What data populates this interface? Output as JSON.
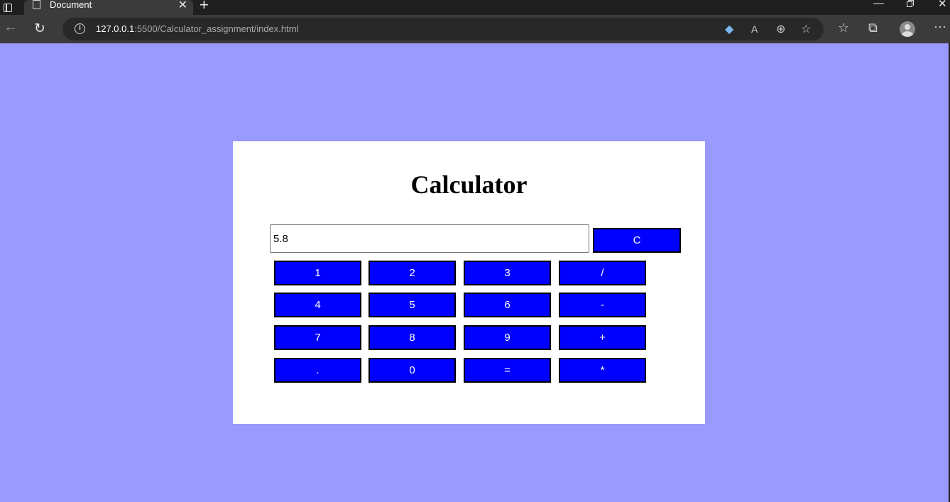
{
  "browser": {
    "tab_title": "Document",
    "url_host": "127.0.0.1",
    "url_rest": ":5500/Calculator_assignment/index.html",
    "icons": {
      "tab_actions": "tab-actions-icon",
      "new_tab": "+",
      "minimize": "—",
      "close_window": "✕",
      "close_tab": "✕",
      "back": "←",
      "reload": "↻",
      "info": "i",
      "tag": "◆",
      "read_aloud": "A",
      "zoom": "⊕",
      "add_favorite": "☆",
      "favorites": "☆",
      "collections": "⧉",
      "more": "···"
    }
  },
  "colors": {
    "page_background": "#9a99fd",
    "button_background": "#0000ff",
    "button_text": "#ffffff",
    "card_background": "#ffffff"
  },
  "calculator": {
    "title": "Calculator",
    "display_value": "5.8",
    "clear_label": "C",
    "rows": [
      [
        "1",
        "2",
        "3",
        "/"
      ],
      [
        "4",
        "5",
        "6",
        "-"
      ],
      [
        "7",
        "8",
        "9",
        "+"
      ],
      [
        ".",
        "0",
        "=",
        "*"
      ]
    ]
  }
}
